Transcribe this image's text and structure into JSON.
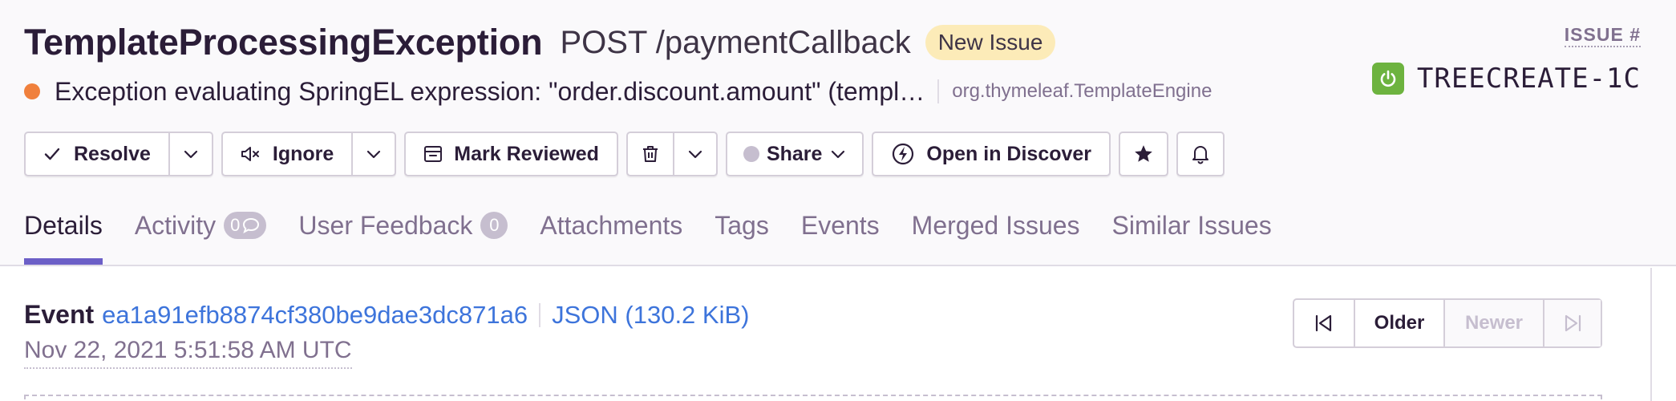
{
  "header": {
    "issue_type": "TemplateProcessingException",
    "transaction": "POST /paymentCallback",
    "status_badge": "New Issue",
    "message": "Exception evaluating SpringEL expression: \"order.discount.amount\" (templ…",
    "culprit": "org.thymeleaf.TemplateEngine",
    "issue_hash_label": "ISSUE #",
    "short_id": "TREECREATE-1C",
    "level_color": "#f0803c",
    "platform_icon": "spring-boot-icon"
  },
  "actions": {
    "resolve": "Resolve",
    "ignore": "Ignore",
    "mark_reviewed": "Mark Reviewed",
    "share": "Share",
    "open_in_discover": "Open in Discover"
  },
  "tabs": [
    {
      "label": "Details",
      "active": true
    },
    {
      "label": "Activity",
      "count": "0"
    },
    {
      "label": "User Feedback",
      "count": "0"
    },
    {
      "label": "Attachments"
    },
    {
      "label": "Tags"
    },
    {
      "label": "Events"
    },
    {
      "label": "Merged Issues"
    },
    {
      "label": "Similar Issues"
    }
  ],
  "event": {
    "label": "Event",
    "id": "ea1a91efb8874cf380be9dae3dc871a6",
    "json_link": "JSON (130.2 KiB)",
    "date": "Nov 22, 2021 5:51:58 AM UTC"
  },
  "pager": {
    "older": "Older",
    "newer": "Newer"
  },
  "colors": {
    "accent": "#6c5fc7",
    "link": "#3d74db",
    "badge_bg": "#fcebb8",
    "spring_green": "#6db33f"
  }
}
